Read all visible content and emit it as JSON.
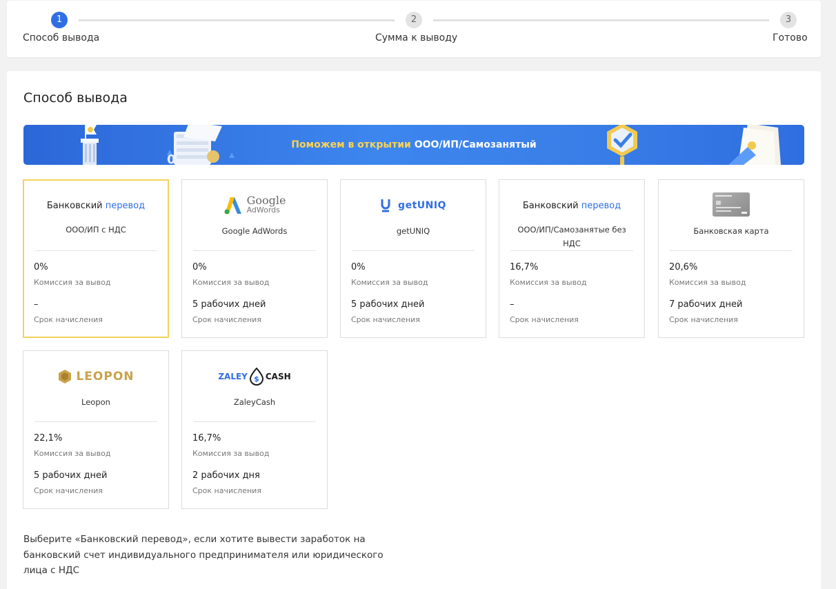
{
  "stepper": {
    "steps": [
      {
        "num": "1",
        "label": "Способ вывода"
      },
      {
        "num": "2",
        "label": "Сумма к выводу"
      },
      {
        "num": "3",
        "label": "Готово"
      }
    ]
  },
  "main": {
    "title": "Способ вывода",
    "banner": {
      "text_highlight": "Поможем в открытии",
      "text_rest": " ООО/ИП/Самозанятый"
    },
    "cards": [
      {
        "logo_part1": "Банковский",
        "logo_part2": "перевод",
        "name": "ООО/ИП с НДС",
        "commission": "0%",
        "commission_label": "Комиссия за вывод",
        "term": "–",
        "term_label": "Срок начисления"
      },
      {
        "logo_text1": "Google",
        "logo_text2": "AdWords",
        "name": "Google AdWords",
        "commission": "0%",
        "commission_label": "Комиссия за вывод",
        "term": "5 рабочих дней",
        "term_label": "Срок начисления"
      },
      {
        "logo_text": "getUNIQ",
        "name": "getUNIQ",
        "commission": "0%",
        "commission_label": "Комиссия за вывод",
        "term": "5 рабочих дней",
        "term_label": "Срок начисления"
      },
      {
        "logo_part1": "Банковский",
        "logo_part2": "перевод",
        "name": "ООО/ИП/Самозанятые без НДС",
        "commission": "16,7%",
        "commission_label": "Комиссия за вывод",
        "term": "–",
        "term_label": "Срок начисления"
      },
      {
        "name": "Банковская карта",
        "commission": "20,6%",
        "commission_label": "Комиссия за вывод",
        "term": "7 рабочих дней",
        "term_label": "Срок начисления"
      },
      {
        "logo_text": "LEOPON",
        "name": "Leopon",
        "commission": "22,1%",
        "commission_label": "Комиссия за вывод",
        "term": "5 рабочих дней",
        "term_label": "Срок начисления"
      },
      {
        "logo_text1": "ZALEY",
        "logo_text2": "CASH",
        "name": "ZaleyCash",
        "commission": "16,7%",
        "commission_label": "Комиссия за вывод",
        "term": "2 рабочих дня",
        "term_label": "Срок начисления"
      }
    ],
    "hint": "Выберите «Банковский перевод», если хотите вывести заработок на банковский счет индивидуального предпринимателя или юридического лица с НДС"
  },
  "colors": {
    "accent": "#2f6ee5",
    "selected_border": "#f2d25a",
    "banner_highlight": "#ffd34d"
  }
}
